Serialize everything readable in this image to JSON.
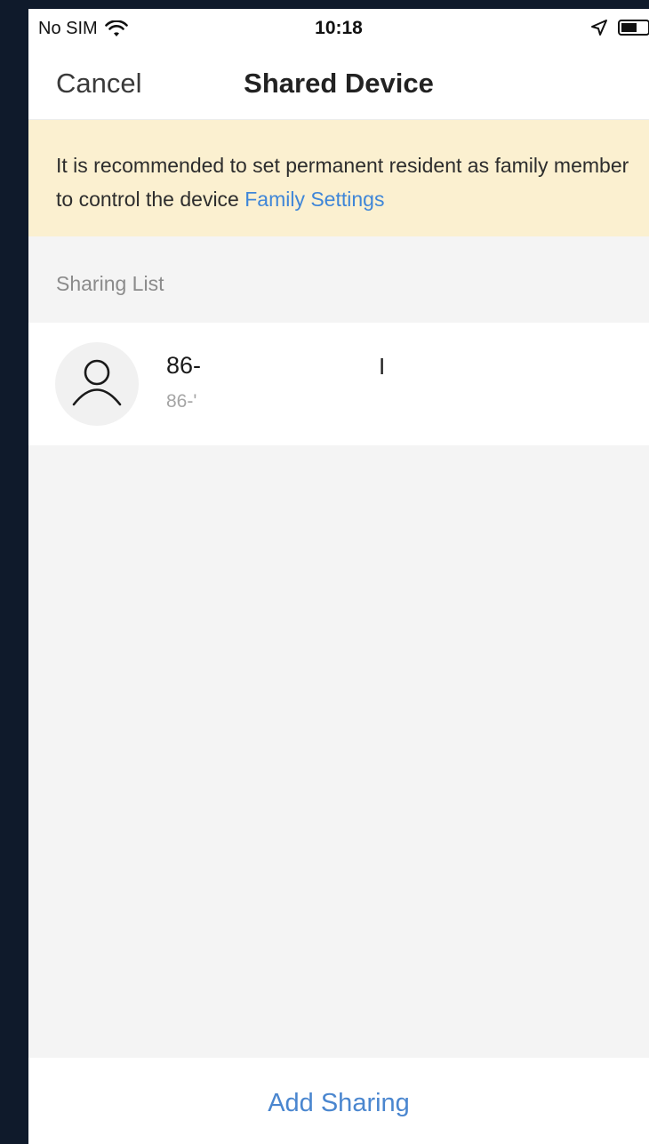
{
  "status_bar": {
    "carrier": "No SIM",
    "time": "10:18",
    "icons": [
      "wifi-icon",
      "location-arrow-icon",
      "battery-icon"
    ]
  },
  "nav": {
    "cancel_label": "Cancel",
    "title": "Shared Device"
  },
  "notice": {
    "text": "It is recommended to set permanent resident as family member to control the device",
    "link_label": "Family Settings",
    "background": "#fbf0d0",
    "link_color": "#3f86d8"
  },
  "sharing_list": {
    "header": "Sharing List",
    "items": [
      {
        "title": "86-",
        "title_suffix": "I",
        "subtitle": "86-'",
        "icon": "user-icon"
      }
    ]
  },
  "footer": {
    "add_sharing_label": "Add Sharing",
    "accent": "#4a86cf"
  }
}
